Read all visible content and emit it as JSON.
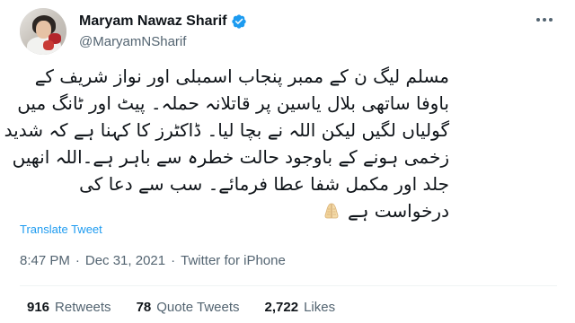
{
  "user": {
    "display_name": "Maryam Nawaz Sharif",
    "handle": "@MaryamNSharif",
    "verified": true
  },
  "tweet": {
    "lines": [
      "مسلم لیگ ن کے ممبر پنجاب اسمبلی اور نواز شریف کے",
      "باوفا ساتھی بلال یاسین پر قاتلانہ حملہ۔ پیٹ اور ٹانگ میں",
      "گولیاں لگیں لیکن اللہ نے بچا لیا۔ ڈاکٹرز کا کہنا ہے کہ شدید",
      "زخمی ہونے کے باوجود حالت خطرہ سے باہر ہے۔اللہ انھیں",
      "جلد اور مکمل شفا عطا فرمائے۔ سب سے دعا کی",
      "درخواست ہے"
    ],
    "emoji": "folded-hands-icon"
  },
  "translate_label": "Translate Tweet",
  "meta": {
    "time": "8:47 PM",
    "separator": "·",
    "date": "Dec 31, 2021",
    "source": "Twitter for iPhone"
  },
  "stats": {
    "retweets_count": "916",
    "retweets_label": "Retweets",
    "quotes_count": "78",
    "quotes_label": "Quote Tweets",
    "likes_count": "2,722",
    "likes_label": "Likes"
  },
  "colors": {
    "link": "#1d9bf0",
    "secondary": "#536471",
    "primary_text": "#0f1419",
    "verified": "#1d9bf0"
  }
}
